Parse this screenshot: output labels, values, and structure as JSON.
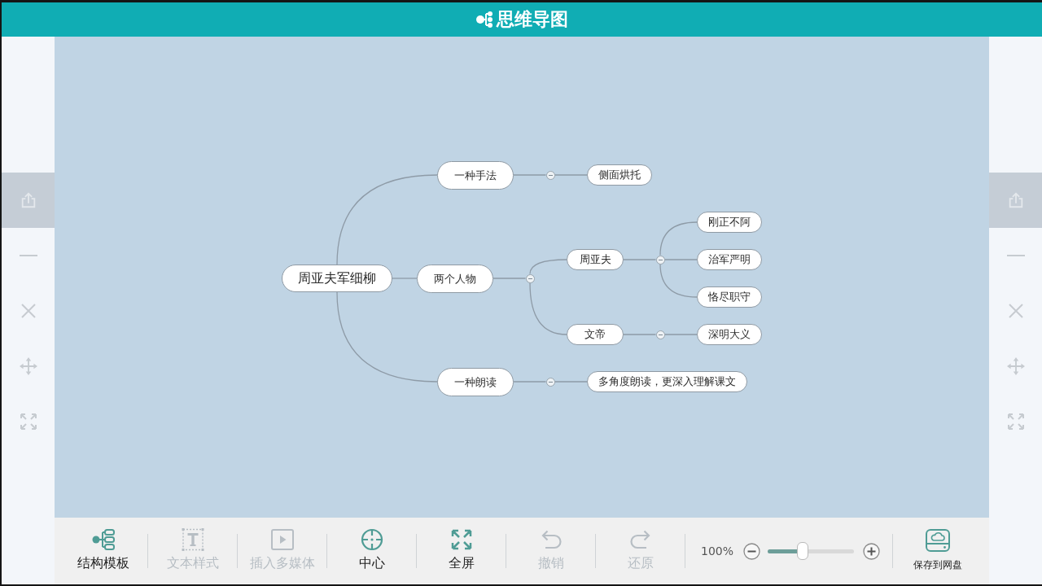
{
  "header": {
    "title": "思维导图"
  },
  "left_panel": {
    "items": [
      {
        "selected": true
      },
      {
        "selected": false
      },
      {
        "selected": false
      },
      {
        "selected": false
      },
      {
        "selected": false
      }
    ]
  },
  "mind_map": {
    "root": {
      "text": "周亚夫军细柳",
      "children": [
        {
          "text": "一种手法",
          "expanded": true,
          "children": [
            {
              "text": "侧面烘托"
            }
          ]
        },
        {
          "text": "两个人物",
          "expanded": true,
          "children": [
            {
              "text": "周亚夫",
              "expanded": true,
              "children": [
                {
                  "text": "刚正不阿"
                },
                {
                  "text": "治军严明"
                },
                {
                  "text": "恪尽职守"
                }
              ]
            },
            {
              "text": "文帝",
              "expanded": true,
              "children": [
                {
                  "text": "深明大义"
                }
              ]
            }
          ]
        },
        {
          "text": "一种朗读",
          "expanded": true,
          "children": [
            {
              "text": "多角度朗读，更深入理解课文"
            }
          ]
        }
      ]
    }
  },
  "right_panel": {
    "items": [
      {
        "selected": true
      },
      {
        "selected": false
      },
      {
        "selected": false
      },
      {
        "selected": false
      },
      {
        "selected": false
      }
    ]
  },
  "toolbar": {
    "tools": [
      {
        "label": "结构模板",
        "disabled": false
      },
      {
        "label": "文本样式",
        "disabled": true
      },
      {
        "label": "插入多媒体",
        "disabled": true
      },
      {
        "label": "中心",
        "disabled": false
      },
      {
        "label": "全屏",
        "disabled": false
      },
      {
        "label": "撤销",
        "disabled": true
      },
      {
        "label": "还原",
        "disabled": true
      }
    ],
    "zoom": {
      "reading": "100%",
      "level": 0.41
    },
    "save": {
      "label": "保存到网盘"
    }
  }
}
